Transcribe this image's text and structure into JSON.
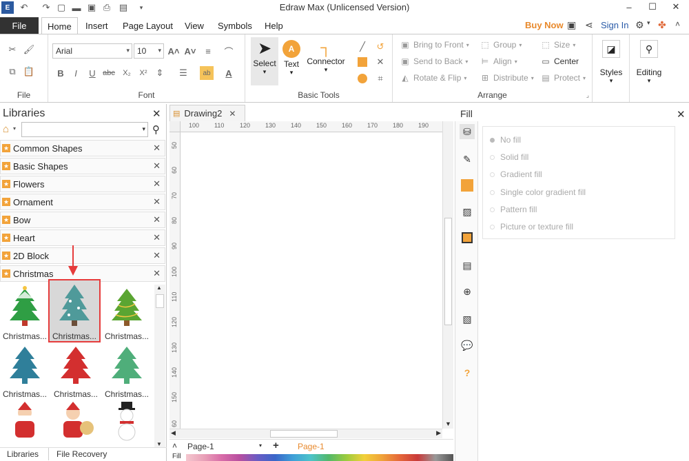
{
  "app": {
    "title": "Edraw Max (Unlicensed Version)"
  },
  "menu": {
    "file": "File",
    "tabs": [
      "Home",
      "Insert",
      "Page Layout",
      "View",
      "Symbols",
      "Help"
    ],
    "buy_now": "Buy Now",
    "sign_in": "Sign In"
  },
  "ribbon": {
    "file_group": "File",
    "font_group": "Font",
    "font_name": "Arial",
    "font_size": "10",
    "basic_tools_group": "Basic Tools",
    "select": "Select",
    "text": "Text",
    "connector": "Connector",
    "arrange_group": "Arrange",
    "bring_to_front": "Bring to Front",
    "send_to_back": "Send to Back",
    "rotate_flip": "Rotate & Flip",
    "group": "Group",
    "align": "Align",
    "distribute": "Distribute",
    "size": "Size",
    "center": "Center",
    "protect": "Protect",
    "styles": "Styles",
    "editing": "Editing"
  },
  "libraries": {
    "title": "Libraries",
    "items": [
      "Common Shapes",
      "Basic Shapes",
      "Flowers",
      "Ornament",
      "Bow",
      "Heart",
      "2D Block",
      "Christmas"
    ],
    "shapes": [
      "Christmas...",
      "Christmas...",
      "Christmas...",
      "Christmas...",
      "Christmas...",
      "Christmas..."
    ],
    "bottom_tabs": [
      "Libraries",
      "File Recovery"
    ]
  },
  "document": {
    "tab": "Drawing2",
    "hruler_ticks": [
      "100",
      "110",
      "120",
      "130",
      "140",
      "150",
      "160",
      "170",
      "180",
      "190"
    ],
    "vruler_ticks": [
      "50",
      "60",
      "70",
      "80",
      "90",
      "100",
      "110",
      "120",
      "130",
      "140",
      "150",
      "60"
    ],
    "page_selector": "Page-1",
    "active_page": "Page-1",
    "fill_label": "Fill"
  },
  "fill_panel": {
    "title": "Fill",
    "options": [
      "No fill",
      "Solid fill",
      "Gradient fill",
      "Single color gradient fill",
      "Pattern fill",
      "Picture or texture fill"
    ],
    "selected": 0
  },
  "colors": {
    "accent_orange": "#f2a33a",
    "buy_now": "#e8892c",
    "sign_in": "#2a5ba8",
    "file_tab": "#323232",
    "selection_red": "#e63b3b",
    "tree_green": "#2f9e44",
    "tree_teal": "#2f7f9a",
    "tree_red": "#d32f2f"
  }
}
